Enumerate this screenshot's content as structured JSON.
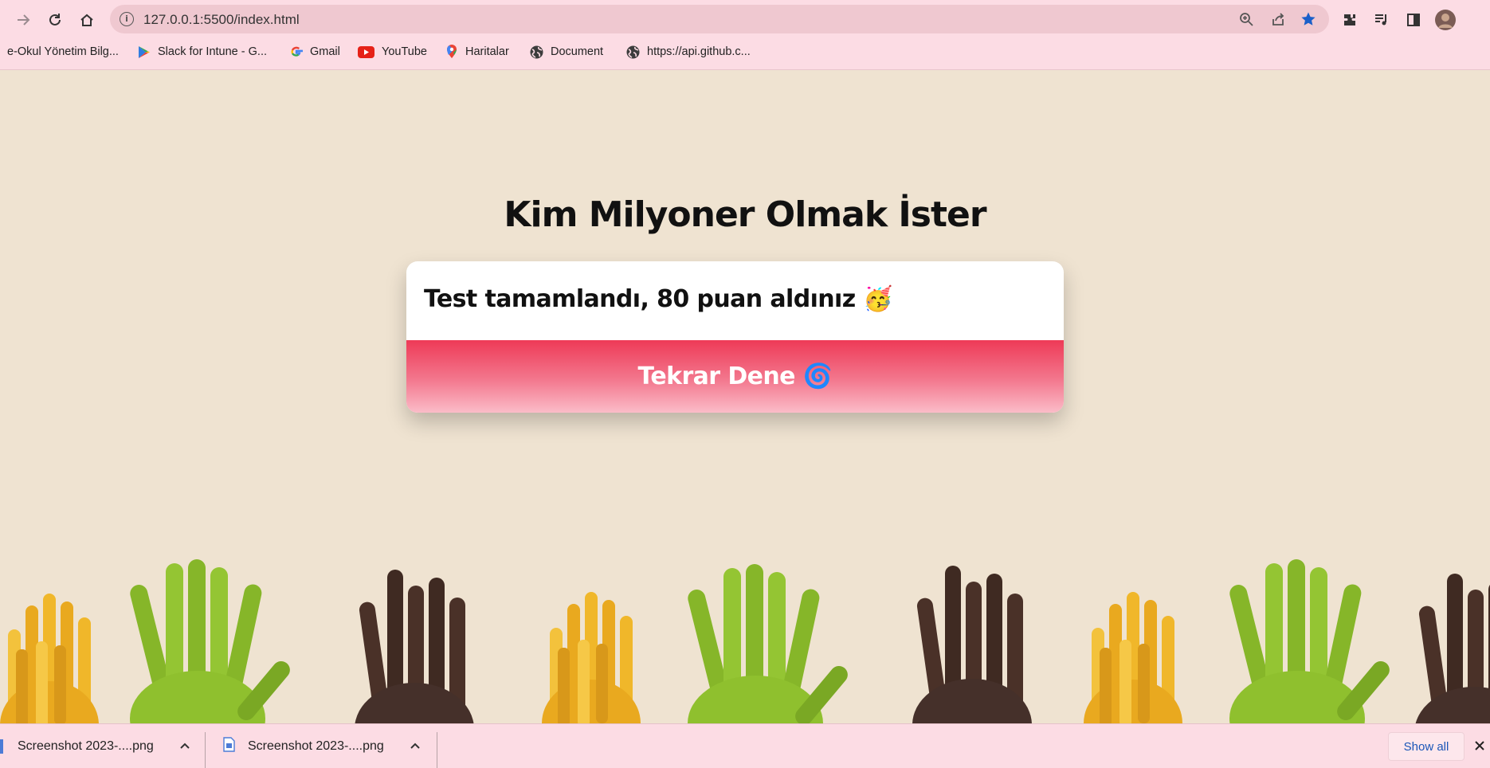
{
  "browser": {
    "url": "127.0.0.1:5500/index.html",
    "bookmarks": [
      {
        "label": "e-Okul Yönetim Bilg...",
        "icon": "none"
      },
      {
        "label": "Slack for Intune - G...",
        "icon": "google-play-icon"
      },
      {
        "label": "Gmail",
        "icon": "google-icon"
      },
      {
        "label": "YouTube",
        "icon": "youtube-icon"
      },
      {
        "label": "Haritalar",
        "icon": "maps-icon"
      },
      {
        "label": "Document",
        "icon": "globe-icon"
      },
      {
        "label": "https://api.github.c...",
        "icon": "globe-icon"
      }
    ]
  },
  "page": {
    "title": "Kim Milyoner Olmak İster",
    "result_text": "Test tamamlandı, 80 puan aldınız 🥳",
    "retry_label": "Tekrar Dene 🌀"
  },
  "downloads": {
    "items": [
      {
        "label": "Screenshot 2023-....png"
      },
      {
        "label": "Screenshot 2023-....png"
      }
    ],
    "show_all": "Show all"
  },
  "colors": {
    "page_bg": "#efe3d1",
    "chrome_bg": "#fcdce4",
    "button_top": "#ee3a57",
    "button_bottom": "#fbbcc8",
    "hand_yellow": "#f0b72a",
    "hand_green": "#8fc02e",
    "hand_brown": "#4a3128"
  }
}
